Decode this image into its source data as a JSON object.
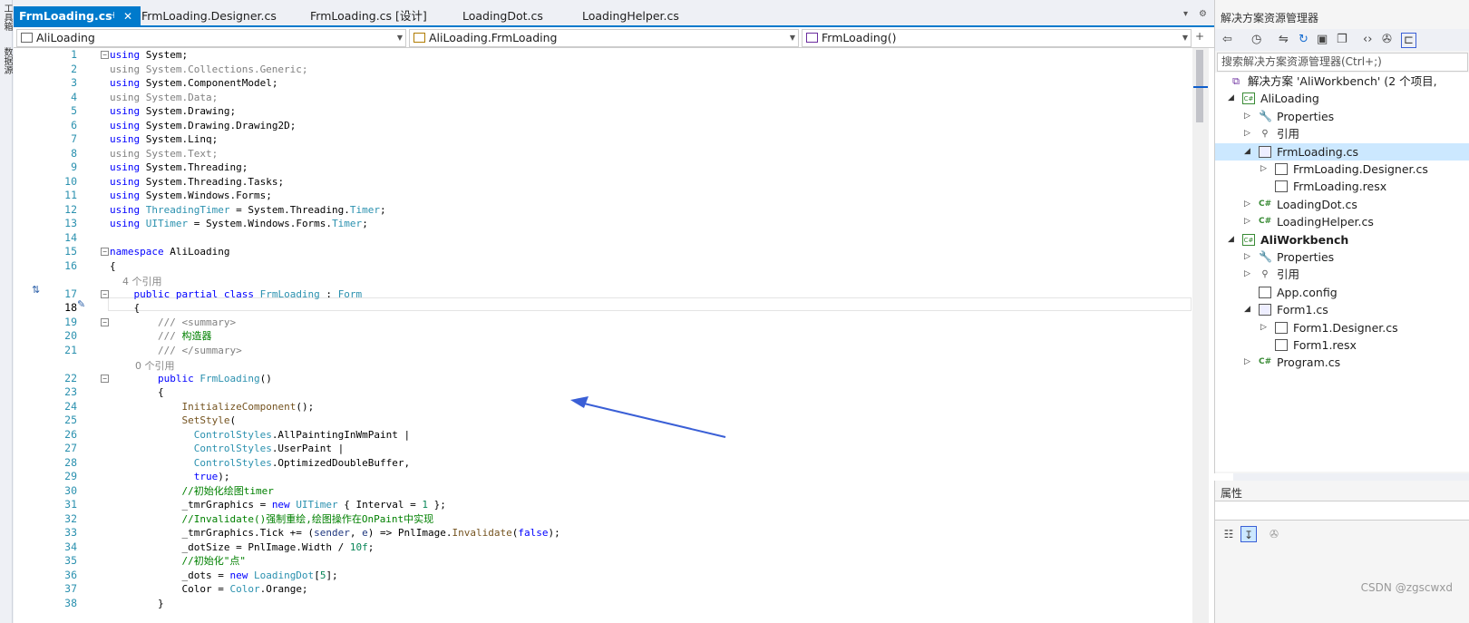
{
  "left_strip": {
    "tab1": "工具箱",
    "tab2": "数据源"
  },
  "tabs": [
    {
      "label": "FrmLoading.cs",
      "active": true
    },
    {
      "label": "FrmLoading.Designer.cs"
    },
    {
      "label": "FrmLoading.cs [设计]"
    },
    {
      "label": "LoadingDot.cs"
    },
    {
      "label": "LoadingHelper.cs"
    }
  ],
  "tab_pin": "⊣",
  "tab_close": "✕",
  "tabbar_icons": {
    "overflow": "▾",
    "settings": "⚙"
  },
  "nav": {
    "project": "AliLoading",
    "type": "AliLoading.FrmLoading",
    "member": "FrmLoading()"
  },
  "code_lines": [
    {
      "n": "1",
      "fold": "⊟",
      "html": "<span class='kw'>using</span> System;"
    },
    {
      "n": "2",
      "html": "<span class='gr'>using System.Collections.Generic;</span>"
    },
    {
      "n": "3",
      "html": "<span class='kw'>using</span> System.ComponentModel;"
    },
    {
      "n": "4",
      "html": "<span class='gr'>using System.Data;</span>"
    },
    {
      "n": "5",
      "html": "<span class='kw'>using</span> System.Drawing;"
    },
    {
      "n": "6",
      "html": "<span class='kw'>using</span> System.Drawing.Drawing2D;"
    },
    {
      "n": "7",
      "html": "<span class='kw'>using</span> System.Linq;"
    },
    {
      "n": "8",
      "html": "<span class='gr'>using System.Text;</span>"
    },
    {
      "n": "9",
      "html": "<span class='kw'>using</span> System.Threading;"
    },
    {
      "n": "10",
      "html": "<span class='kw'>using</span> System.Threading.Tasks;"
    },
    {
      "n": "11",
      "html": "<span class='kw'>using</span> System.Windows.Forms;"
    },
    {
      "n": "12",
      "html": "<span class='kw'>using</span> <span class='ty'>ThreadingTimer</span> = System.Threading.<span class='ty'>Timer</span>;"
    },
    {
      "n": "13",
      "html": "<span class='kw'>using</span> <span class='ty'>UITimer</span> = System.Windows.Forms.<span class='ty'>Timer</span>;"
    },
    {
      "n": "14",
      "html": ""
    },
    {
      "n": "15",
      "fold": "⊟",
      "html": "<span class='kw'>namespace</span> AliLoading"
    },
    {
      "n": "16",
      "html": "{"
    },
    {
      "lens": "    4 个引用"
    },
    {
      "n": "17",
      "fold": "⊟",
      "html": "    <span class='kw'>public partial class</span> <span class='ty'>FrmLoading</span> : <span class='ty'>Form</span>"
    },
    {
      "n": "18",
      "cur": true,
      "html": "    {"
    },
    {
      "n": "19",
      "fold": "⊟",
      "html": "        <span class='gr'>/// &lt;summary&gt;</span>"
    },
    {
      "n": "20",
      "html": "        <span class='gr'>///</span> <span class='cm'>构造器</span>"
    },
    {
      "n": "21",
      "html": "        <span class='gr'>/// &lt;/summary&gt;</span>"
    },
    {
      "lens": "        0 个引用"
    },
    {
      "n": "22",
      "fold": "⊟",
      "html": "        <span class='kw'>public</span> <span class='ty'>FrmLoading</span>()"
    },
    {
      "n": "23",
      "html": "        {"
    },
    {
      "n": "24",
      "html": "            <span class='me'>InitializeComponent</span>();"
    },
    {
      "n": "25",
      "html": "            <span class='me'>SetStyle</span>("
    },
    {
      "n": "26",
      "html": "              <span class='ty'>ControlStyles</span>.AllPaintingInWmPaint |"
    },
    {
      "n": "27",
      "html": "              <span class='ty'>ControlStyles</span>.UserPaint |"
    },
    {
      "n": "28",
      "html": "              <span class='ty'>ControlStyles</span>.OptimizedDoubleBuffer,"
    },
    {
      "n": "29",
      "html": "              <span class='kw'>true</span>);"
    },
    {
      "n": "30",
      "html": "            <span class='cm'>//初始化绘图timer</span>"
    },
    {
      "n": "31",
      "html": "            _tmrGraphics = <span class='kw'>new</span> <span class='ty'>UITimer</span> { Interval = <span class='nu'>1</span> };"
    },
    {
      "n": "32",
      "html": "            <span class='cm'>//Invalidate()强制重绘,绘图操作在OnPaint中实现</span>"
    },
    {
      "n": "33",
      "html": "            _tmrGraphics.Tick += (<span class='pa'>sender</span>, <span class='pa'>e</span>) =&gt; PnlImage.<span class='me'>Invalidate</span>(<span class='kw'>false</span>);"
    },
    {
      "n": "34",
      "html": "            _dotSize = PnlImage.Width / <span class='nu'>10f</span>;"
    },
    {
      "n": "35",
      "html": "            <span class='cm'>//初始化\"点\"</span>"
    },
    {
      "n": "36",
      "html": "            _dots = <span class='kw'>new</span> <span class='ty'>LoadingDot</span>[<span class='nu'>5</span>];"
    },
    {
      "n": "37",
      "html": "            Color = <span class='ty'>Color</span>.Orange;"
    },
    {
      "n": "38",
      "html": "        }"
    }
  ],
  "solution_explorer": {
    "title": "解决方案资源管理器",
    "search_placeholder": "搜索解决方案资源管理器(Ctrl+;)",
    "toolbar_icons": [
      "back-forward",
      "history",
      "sync",
      "refresh",
      "collapse",
      "copy",
      "code",
      "wrench",
      "pin"
    ],
    "items": [
      {
        "label": "解决方案 'AliWorkbench' (2 个项目,",
        "icon": "sln",
        "level": 0
      },
      {
        "label": "AliLoading",
        "icon": "prj",
        "level": 1,
        "exp": "◢"
      },
      {
        "label": "Properties",
        "icon": "wr",
        "level": 2,
        "exp": "▷"
      },
      {
        "label": "引用",
        "icon": "ref",
        "level": 2,
        "exp": "▷"
      },
      {
        "label": "FrmLoading.cs",
        "icon": "frm",
        "level": 2,
        "exp": "◢",
        "selected": true
      },
      {
        "label": "FrmLoading.Designer.cs",
        "icon": "doc",
        "level": 3,
        "exp": "▷"
      },
      {
        "label": "FrmLoading.resx",
        "icon": "doc",
        "level": 3
      },
      {
        "label": "LoadingDot.cs",
        "icon": "cs",
        "level": 2,
        "exp": "▷"
      },
      {
        "label": "LoadingHelper.cs",
        "icon": "cs",
        "level": 2,
        "exp": "▷"
      },
      {
        "label": "AliWorkbench",
        "icon": "prj",
        "level": 1,
        "exp": "◢",
        "bold": true
      },
      {
        "label": "Properties",
        "icon": "wr",
        "level": 2,
        "exp": "▷"
      },
      {
        "label": "引用",
        "icon": "ref",
        "level": 2,
        "exp": "▷"
      },
      {
        "label": "App.config",
        "icon": "doc",
        "level": 2
      },
      {
        "label": "Form1.cs",
        "icon": "frm",
        "level": 2,
        "exp": "◢"
      },
      {
        "label": "Form1.Designer.cs",
        "icon": "doc",
        "level": 3,
        "exp": "▷"
      },
      {
        "label": "Form1.resx",
        "icon": "doc",
        "level": 3
      },
      {
        "label": "Program.cs",
        "icon": "cs",
        "level": 2,
        "exp": "▷"
      }
    ]
  },
  "properties": {
    "title": "属性"
  },
  "watermark": "CSDN @zgscwxd",
  "colors": {
    "accent": "#007acc",
    "keyword": "#0000ff",
    "type": "#2b91af",
    "comment": "#008000",
    "arrow": "#3a5fd6"
  }
}
